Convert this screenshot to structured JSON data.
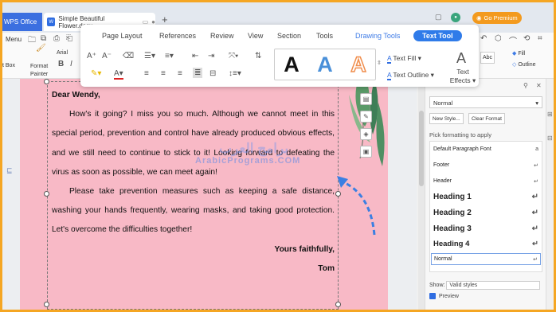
{
  "titlebar": {
    "app_tab": "WPS Office",
    "doc_tab": "Simple Beautiful Flower.docx",
    "doc_icon": "W",
    "new_tab": "+",
    "premium": "Go Premium"
  },
  "ribbon": {
    "menu": "Menu",
    "font_name": "Arial",
    "format_painter": "Format Painter",
    "text_box": "t Box",
    "bold": "B",
    "italic": "I",
    "fill": "Fill",
    "outline": "Outline",
    "abc": "Abc"
  },
  "toolbar": {
    "tabs": [
      "Page Layout",
      "References",
      "Review",
      "View",
      "Section",
      "Tools",
      "Drawing Tools",
      "Text Tool"
    ],
    "text_fill": "Text Fill",
    "text_outline": "Text Outline",
    "text_effects": "Text Effects",
    "style_letter": "A",
    "colors": {
      "black": "#111111",
      "blue": "#4a90d9",
      "orange": "#f08d4c",
      "accent": "#2f7be9"
    }
  },
  "document": {
    "greeting": "Dear Wendy,",
    "paragraphs": [
      "How's it going? I miss you so much. Although we cannot meet in this special period, prevention and control have already produced obvious effects, and we still need to continue to stick to it! Looking forward to defeating the virus as soon as possible, we can meet again!",
      "Please take prevention measures such as keeping a safe distance, washing your hands frequently, wearing masks, and taking good protection. Let's overcome the difficulties together!"
    ],
    "closing": "Yours faithfully,",
    "signature": "Tom",
    "page_color": "#f8b9c6"
  },
  "watermark": {
    "arabic": "برامج العرب",
    "latin": "ArabicPrograms.COM"
  },
  "styles_pane": {
    "current": "Normal",
    "new_style": "New Style...",
    "clear_format": "Clear Format",
    "pick_label": "Pick formatting to apply",
    "items": [
      "Default Paragraph Font",
      "Footer",
      "Header",
      "Heading 1",
      "Heading 2",
      "Heading 3",
      "Heading 4",
      "Normal"
    ],
    "show_label": "Show:",
    "show_value": "Valid styles",
    "preview": "Preview"
  }
}
